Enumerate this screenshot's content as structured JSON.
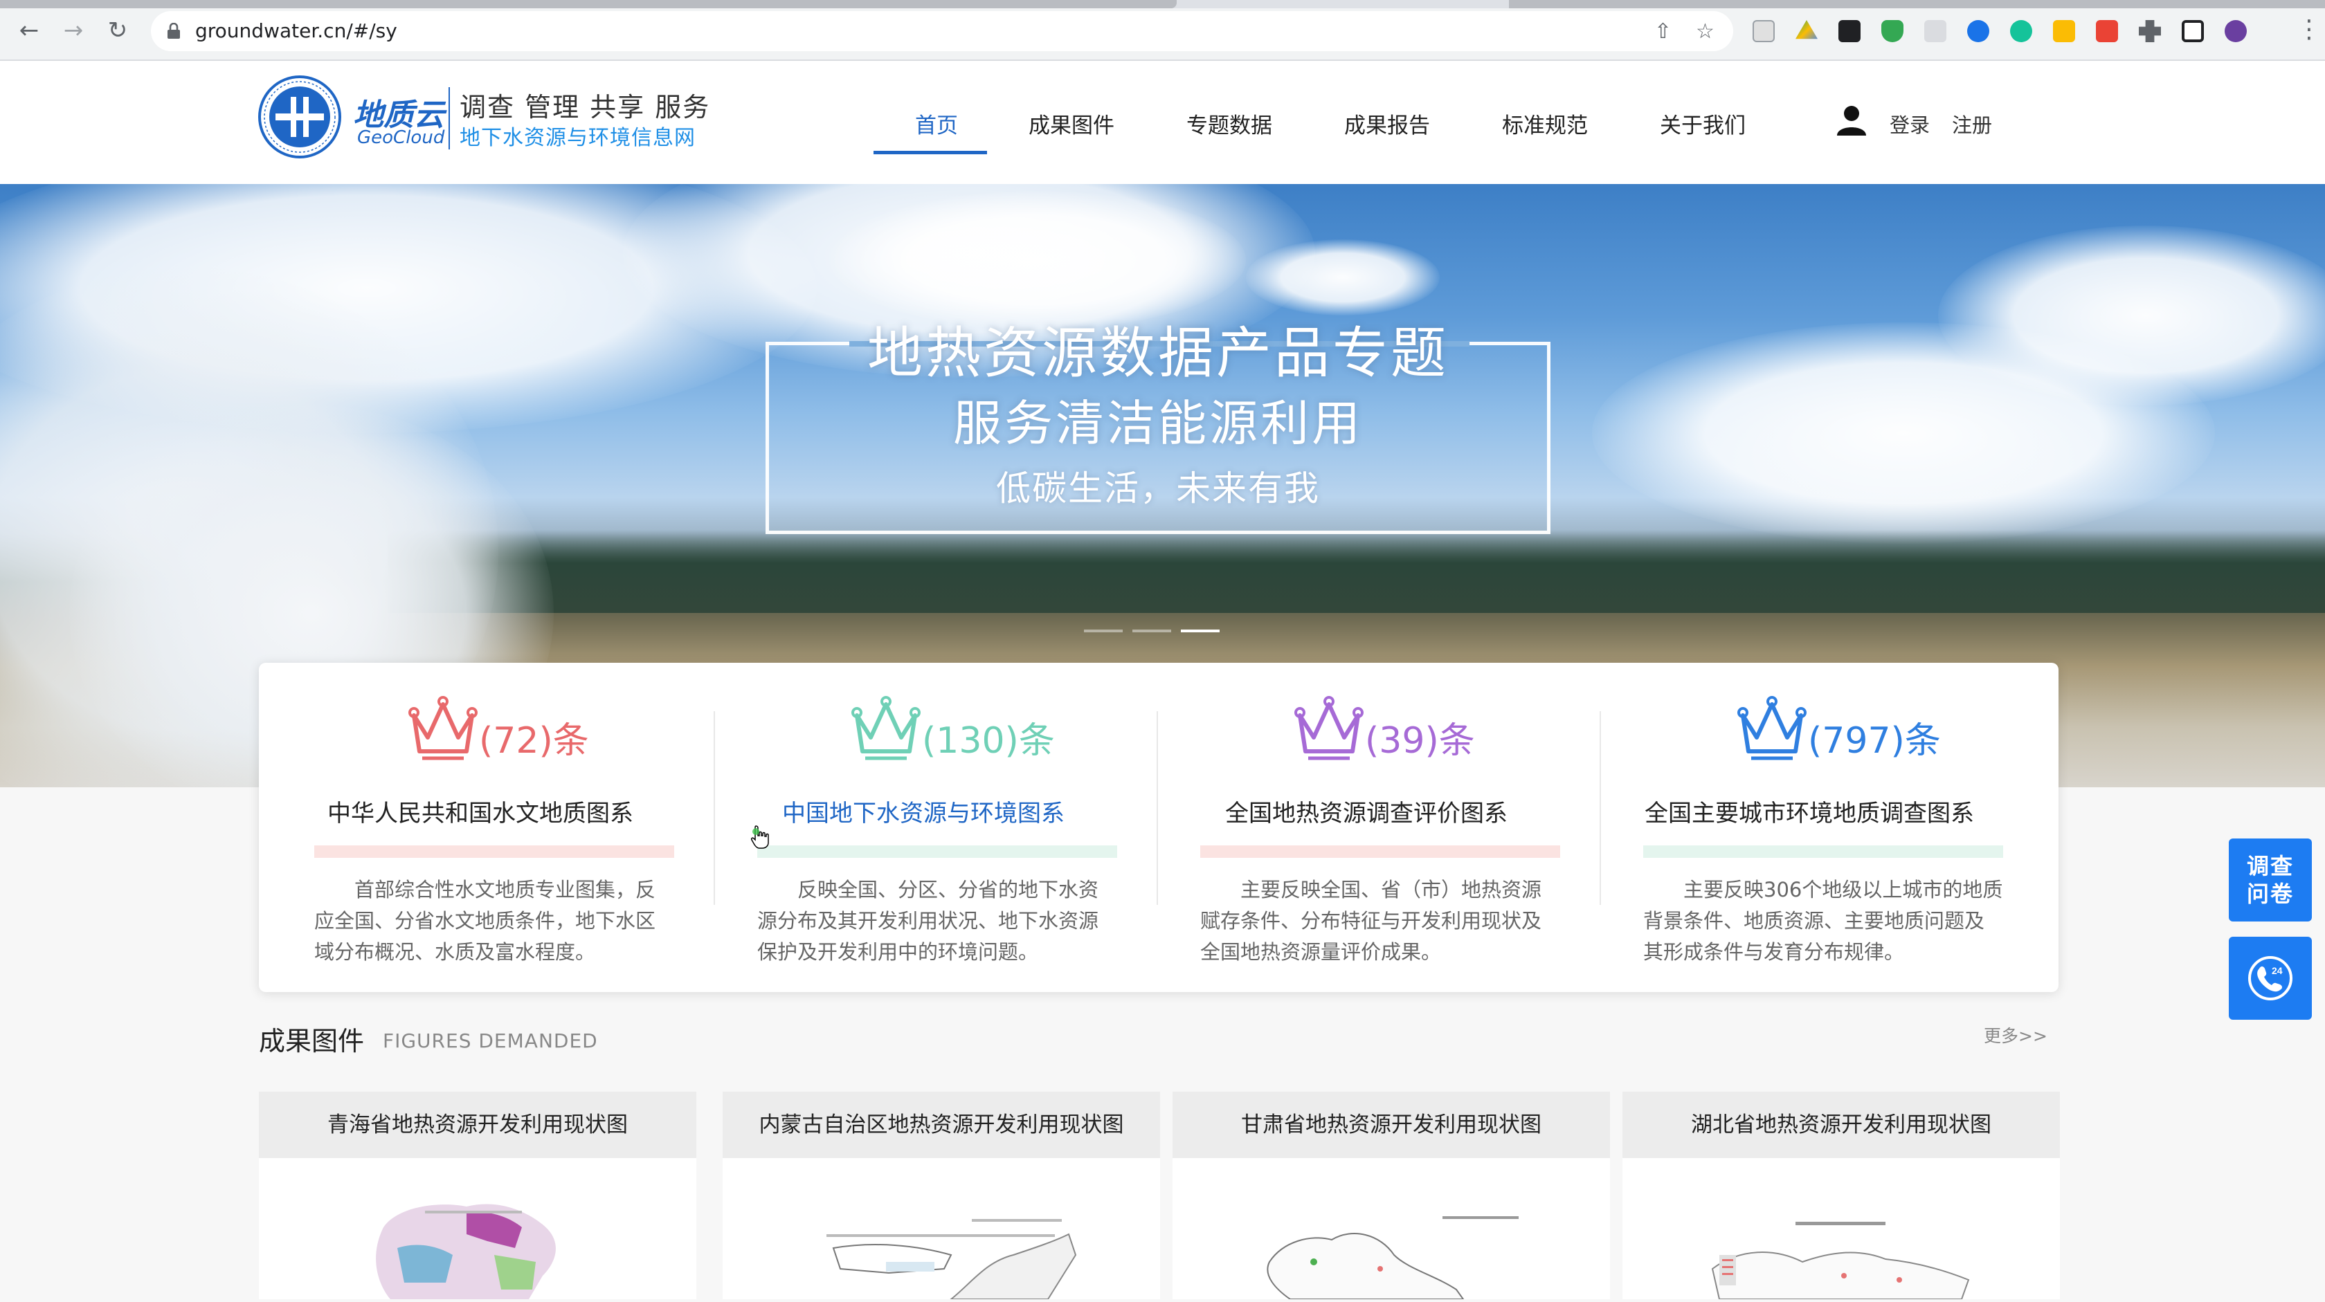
{
  "browser": {
    "url": "groundwater.cn/#/sy"
  },
  "site": {
    "logo_cn": "地质云",
    "logo_en": "GeoCloud",
    "slogan": "调查 管理 共享 服务",
    "subtitle": "地下水资源与环境信息网"
  },
  "nav": {
    "items": [
      "首页",
      "成果图件",
      "专题数据",
      "成果报告",
      "标准规范",
      "关于我们"
    ],
    "active_index": 0,
    "login": "登录",
    "register": "注册"
  },
  "hero": {
    "title": "地热资源数据产品专题",
    "subtitle1": "服务清洁能源利用",
    "subtitle2": "低碳生活，未来有我",
    "slides": 3,
    "active_slide": 3
  },
  "categories": [
    {
      "count": "(72)条",
      "title": "中华人民共和国水文地质图系",
      "desc": "首部综合性水文地质专业图集，反应全国、分省水文地质条件，地下水区域分布概况、水质及富水程度。",
      "color": "#e8696b",
      "bar_color": "#fbe3e1"
    },
    {
      "count": "(130)条",
      "title": "中国地下水资源与环境图系",
      "desc": "反映全国、分区、分省的地下水资源分布及其开发利用状况、地下水资源保护及开发利用中的环境问题。",
      "color": "#6fd0b6",
      "bar_color": "#e4f5ee"
    },
    {
      "count": "(39)条",
      "title": "全国地热资源调查评价图系",
      "desc": "主要反映全国、省（市）地热资源赋存条件、分布特征与开发利用现状及全国地热资源量评价成果。",
      "color": "#a66ad6",
      "bar_color": "#fbe3e1"
    },
    {
      "count": "(797)条",
      "title": "全国主要城市环境地质调查图系",
      "desc": "主要反映306个地级以上城市的地质背景条件、地质资源、主要地质问题及其形成条件与发育分布规律。",
      "color": "#2f7fe0",
      "bar_color": "#e4f5ee"
    }
  ],
  "section": {
    "title": "成果图件",
    "title_en": "FIGURES DEMANDED",
    "more": "更多>>"
  },
  "figures": [
    {
      "title": "青海省地热资源开发利用现状图"
    },
    {
      "title": "内蒙古自治区地热资源开发利用现状图"
    },
    {
      "title": "甘肃省地热资源开发利用现状图"
    },
    {
      "title": "湖北省地热资源开发利用现状图"
    }
  ],
  "side": {
    "survey_label": "调查\n问卷",
    "phone_badge": "24"
  },
  "colors": {
    "brand": "#1f66c5",
    "side_button": "#1d7cf2"
  }
}
